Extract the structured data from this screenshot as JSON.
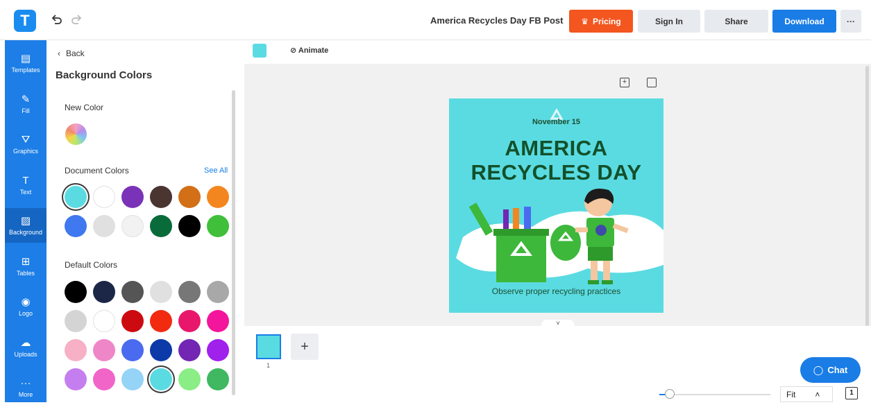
{
  "app": {
    "logo_letter": "T"
  },
  "header": {
    "doc_title": "America Recycles Day FB Post",
    "pricing_label": "Pricing",
    "signin_label": "Sign In",
    "share_label": "Share",
    "download_label": "Download",
    "more_label": "···"
  },
  "sidebar": {
    "items": [
      {
        "label": "Templates",
        "icon": "templates-icon",
        "glyph": "▤"
      },
      {
        "label": "Fill",
        "icon": "fill-icon",
        "glyph": "✎"
      },
      {
        "label": "Graphics",
        "icon": "graphics-icon",
        "glyph": "⛛"
      },
      {
        "label": "Text",
        "icon": "text-icon",
        "glyph": "T"
      },
      {
        "label": "Background",
        "icon": "background-icon",
        "glyph": "▨"
      },
      {
        "label": "Tables",
        "icon": "tables-icon",
        "glyph": "⊞"
      },
      {
        "label": "Logo",
        "icon": "logo-icon",
        "glyph": "◉"
      },
      {
        "label": "Uploads",
        "icon": "uploads-icon",
        "glyph": "☁"
      },
      {
        "label": "More",
        "icon": "more-icon",
        "glyph": "···"
      }
    ],
    "active": "Background"
  },
  "panel": {
    "back_label": "Back",
    "title": "Background Colors",
    "new_color_label": "New Color",
    "document_colors_label": "Document Colors",
    "see_all_label": "See All",
    "default_colors_label": "Default Colors",
    "document_colors": [
      "#5adbe2",
      "#ffffff",
      "#7a33b8",
      "#4a3530",
      "#d26f17",
      "#f3861f",
      "#3f78ef",
      "#e0e0e0",
      "#f2f2f2",
      "#0a6b3a",
      "#000000",
      "#3fbf3a"
    ],
    "default_colors": [
      "#000000",
      "#1c2748",
      "#555555",
      "#e0e0e0",
      "#777777",
      "#a8a8a8",
      "#d4d4d4",
      "#ffffff",
      "#cc0b10",
      "#f12a10",
      "#e8176b",
      "#f3159b",
      "#f7b0c6",
      "#ef86c7",
      "#4a6bef",
      "#0c3aa8",
      "#7226b3",
      "#a020ec",
      "#c57ef0",
      "#f165c8",
      "#95d3f7",
      "#5adbe2",
      "#8aed85",
      "#3fb861"
    ],
    "selected_document_color": 0,
    "selected_default_color": 21
  },
  "toolbar": {
    "color_swatch": "#5adbe2",
    "animate_label": "Animate"
  },
  "design": {
    "background": "#5adbe2",
    "date": "November 15",
    "title_line1": "AMERICA",
    "title_line2": "RECYCLES DAY",
    "subtitle": "Observe proper recycling practices"
  },
  "pages": {
    "page_number": "1",
    "add_label": "+"
  },
  "footer": {
    "chat_label": "Chat",
    "zoom_label": "Fit",
    "page_count": "1"
  }
}
